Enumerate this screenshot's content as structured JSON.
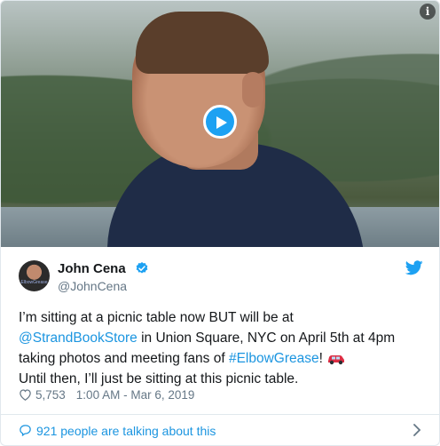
{
  "media": {
    "play_icon": "play-icon",
    "info_glyph": "i"
  },
  "author": {
    "name": "John Cena",
    "handle": "@JohnCena",
    "verified_icon": "verified-badge-icon",
    "avatar_caption": "ElbowGrease"
  },
  "brand_icon": "twitter-bird-icon",
  "tweet": {
    "line1": "I’m sitting at a picnic table now BUT will be at",
    "mention": "@StrandBookStore",
    "line2_rest": " in Union Square, NYC on April 5th at 4pm",
    "line3_start": "taking photos and meeting fans of ",
    "hashtag": "#ElbowGrease",
    "line3_end": "!",
    "emoji_icon": "red-car-icon",
    "line4": "Until then, I’ll just be sitting at this picnic table."
  },
  "meta": {
    "likes": "5,753",
    "timestamp": "1:00 AM - Mar 6, 2019"
  },
  "footer": {
    "talking": "921 people are talking about this"
  },
  "colors": {
    "accent": "#1da1f2",
    "link": "#1b95e0",
    "text": "#14171a",
    "secondary": "#657786",
    "border": "#e1e8ed"
  }
}
